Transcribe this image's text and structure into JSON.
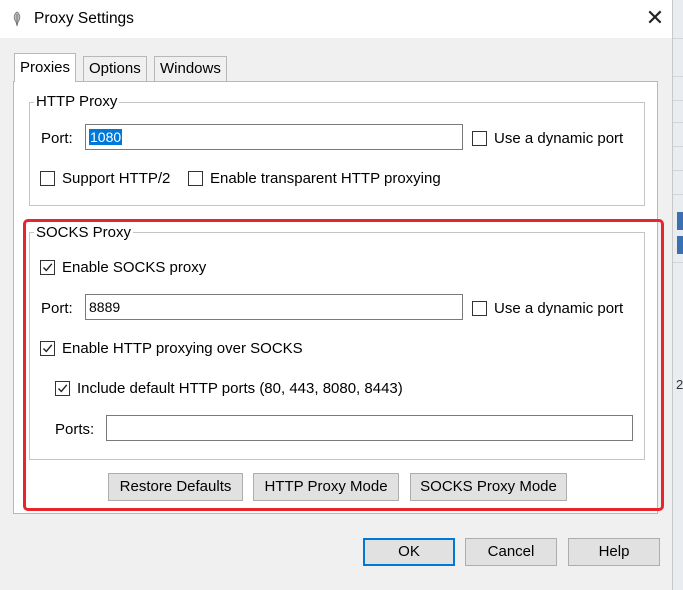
{
  "window": {
    "title": "Proxy Settings",
    "close_glyph": "✕",
    "app_icon": "feather-icon"
  },
  "tabs": [
    {
      "label": "Proxies",
      "active": true
    },
    {
      "label": "Options",
      "active": false
    },
    {
      "label": "Windows",
      "active": false
    }
  ],
  "http_proxy": {
    "legend": "HTTP Proxy",
    "port_label": "Port:",
    "port_value": "1080",
    "dynamic_port_label": "Use a dynamic port",
    "dynamic_port_checked": false,
    "http2_label": "Support HTTP/2",
    "http2_checked": false,
    "transparent_label": "Enable transparent HTTP proxying",
    "transparent_checked": false
  },
  "socks_proxy": {
    "legend": "SOCKS Proxy",
    "enable_label": "Enable SOCKS proxy",
    "enable_checked": true,
    "port_label": "Port:",
    "port_value": "8889",
    "dynamic_port_label": "Use a dynamic port",
    "dynamic_port_checked": false,
    "http_over_socks_label": "Enable HTTP proxying over SOCKS",
    "http_over_socks_checked": true,
    "include_default_ports_label": "Include default HTTP ports (80, 443, 8080, 8443)",
    "include_default_ports_checked": true,
    "ports_label": "Ports:",
    "ports_value": ""
  },
  "mode_buttons": {
    "restore_defaults": "Restore Defaults",
    "http_proxy_mode": "HTTP Proxy Mode",
    "socks_proxy_mode": "SOCKS Proxy Mode"
  },
  "dialog_buttons": {
    "ok": "OK",
    "cancel": "Cancel",
    "help": "Help"
  },
  "background_window": {
    "partial_text": "2"
  },
  "colors": {
    "highlight_border": "#e8252a",
    "selection": "#0078d7",
    "dialog_background": "#f0f0f0"
  }
}
